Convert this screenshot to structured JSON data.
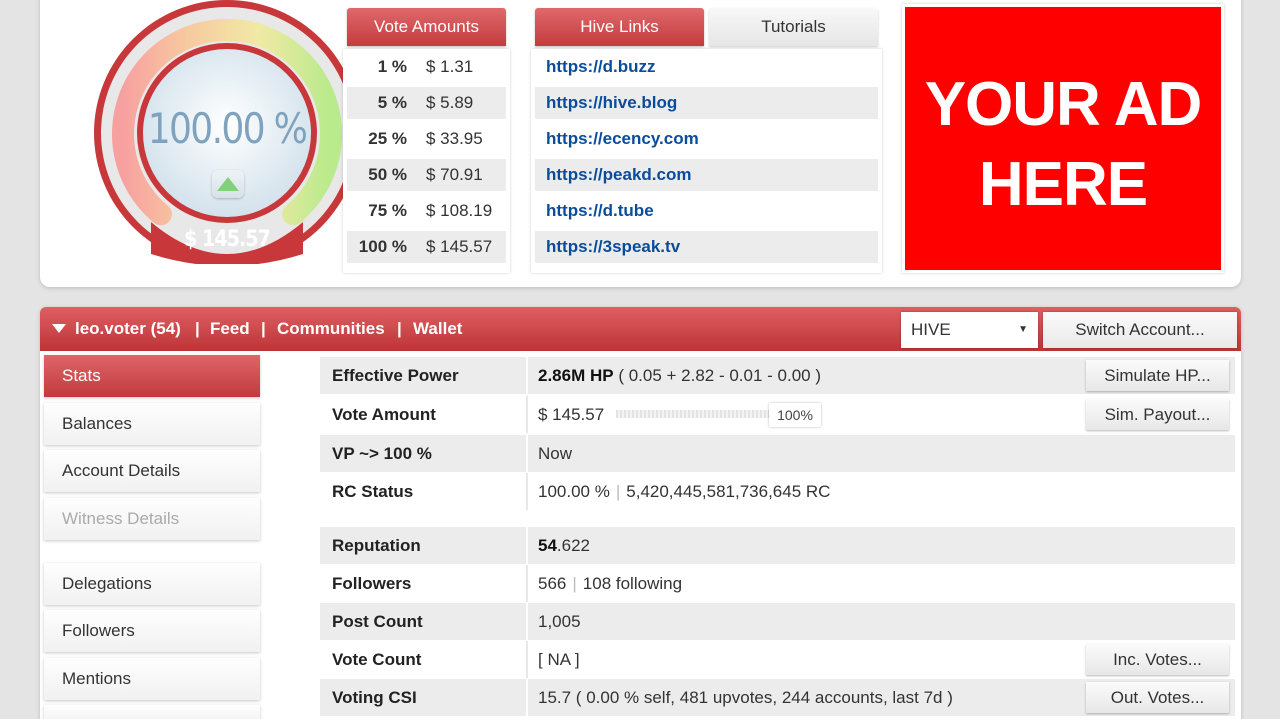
{
  "gauge": {
    "percent": "100.00 %",
    "value": "$ 145.57"
  },
  "vote_amounts": {
    "title": "Vote Amounts",
    "rows": [
      {
        "pct": "1 %",
        "amount": "$ 1.31"
      },
      {
        "pct": "5 %",
        "amount": "$ 5.89"
      },
      {
        "pct": "25 %",
        "amount": "$ 33.95"
      },
      {
        "pct": "50 %",
        "amount": "$ 70.91"
      },
      {
        "pct": "75 %",
        "amount": "$ 108.19"
      },
      {
        "pct": "100 %",
        "amount": "$ 145.57"
      }
    ]
  },
  "links": {
    "tab_active": "Hive Links",
    "tab_other": "Tutorials",
    "items": [
      "https://d.buzz",
      "https://hive.blog",
      "https://ecency.com",
      "https://peakd.com",
      "https://d.tube",
      "https://3speak.tv"
    ]
  },
  "ad": {
    "line1": "YOUR AD",
    "line2": "HERE"
  },
  "account_bar": {
    "account": "leo.voter (54)",
    "sep": "|",
    "feed": "Feed",
    "communities": "Communities",
    "wallet": "Wallet",
    "chain_select": "HIVE",
    "switch_account": "Switch Account..."
  },
  "sidebar": {
    "items": [
      "Stats",
      "Balances",
      "Account Details",
      "Witness Details",
      "Delegations",
      "Followers",
      "Mentions"
    ]
  },
  "stats": {
    "effective_power": {
      "label": "Effective Power",
      "value_bold": "2.86M HP",
      "value_rest": " ( 0.05 + 2.82 - 0.01 - 0.00 )",
      "button": "Simulate HP..."
    },
    "vote_amount": {
      "label": "Vote Amount",
      "value": "$ 145.57",
      "percent_label": "100%",
      "percent": 100,
      "button": "Sim. Payout..."
    },
    "vp": {
      "label": "VP ~> 100 %",
      "value": "Now"
    },
    "rc": {
      "label": "RC Status",
      "value_a": "100.00 %",
      "sep": "|",
      "value_b": "5,420,445,581,736,645 RC"
    },
    "reputation": {
      "label": "Reputation",
      "value_bold": "54",
      "value_rest": ".622"
    },
    "followers": {
      "label": "Followers",
      "value_a": "566",
      "sep": "|",
      "value_b": "108 following"
    },
    "post_count": {
      "label": "Post Count",
      "value": "1,005"
    },
    "vote_count": {
      "label": "Vote Count",
      "value": "[ NA ]",
      "button": "Inc. Votes..."
    },
    "voting_csi": {
      "label": "Voting CSI",
      "value": "15.7 ( 0.00 % self, 481 upvotes, 244 accounts, last 7d )",
      "button": "Out. Votes..."
    }
  },
  "colors": {
    "brand_red": "#c23c3f",
    "link_blue": "#0a4c9c",
    "ad_red": "#ff0000"
  }
}
